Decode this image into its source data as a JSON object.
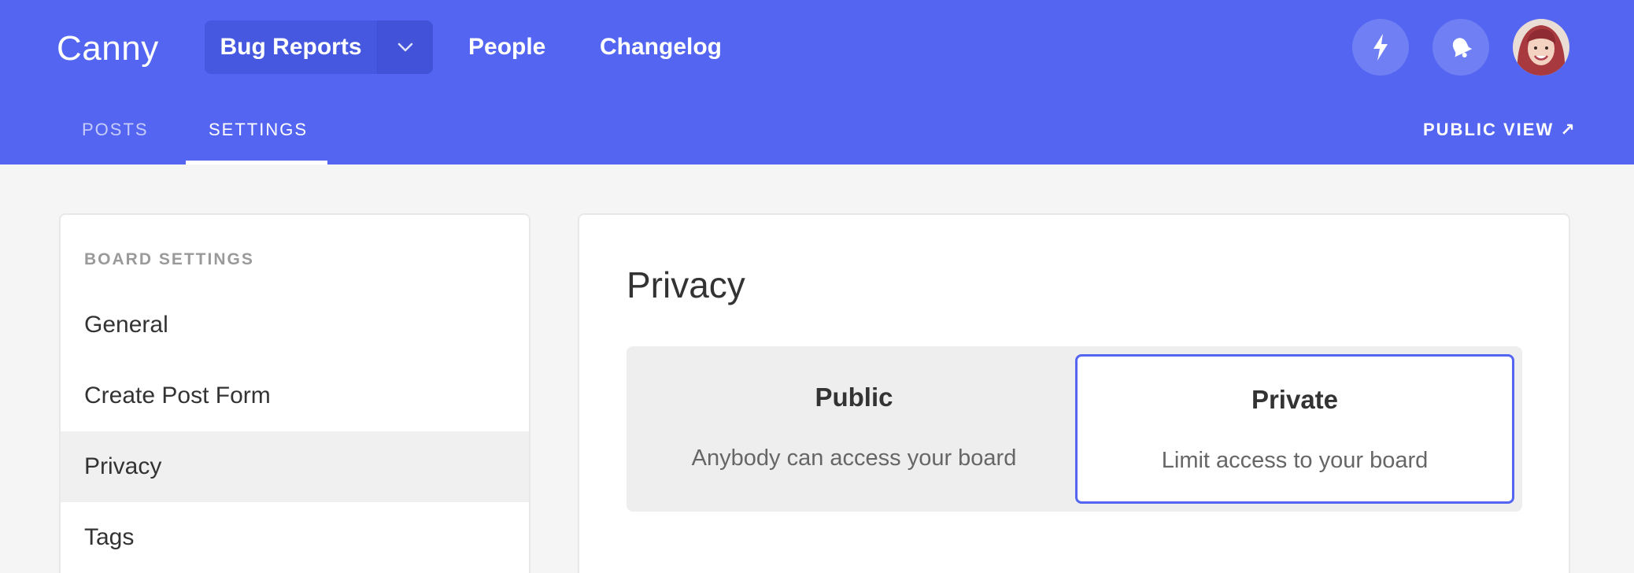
{
  "header": {
    "logo": "Canny",
    "board_name": "Bug Reports",
    "nav": [
      "People",
      "Changelog"
    ],
    "icons": [
      "lightning-icon",
      "bell-icon"
    ]
  },
  "tabs": {
    "posts": "POSTS",
    "settings": "SETTINGS",
    "active": "settings",
    "public_view": "PUBLIC VIEW ↗"
  },
  "sidebar": {
    "heading": "BOARD SETTINGS",
    "items": [
      {
        "label": "General"
      },
      {
        "label": "Create Post Form"
      },
      {
        "label": "Privacy",
        "active": true
      },
      {
        "label": "Tags"
      }
    ]
  },
  "main": {
    "title": "Privacy",
    "options": [
      {
        "title": "Public",
        "description": "Anybody can access your board"
      },
      {
        "title": "Private",
        "description": "Limit access to your board",
        "selected": true
      }
    ]
  },
  "colors": {
    "brand": "#5466f1",
    "background": "#f5f5f5"
  }
}
